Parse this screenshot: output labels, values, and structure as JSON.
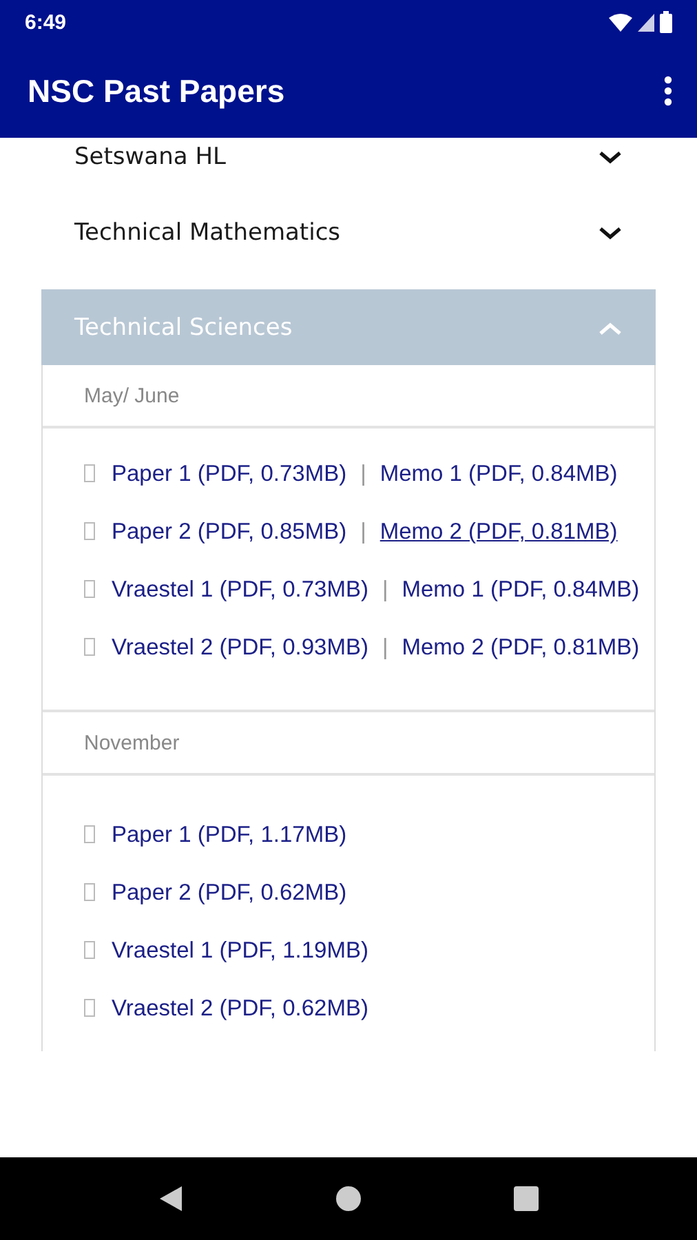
{
  "status_bar": {
    "time": "6:49"
  },
  "app_bar": {
    "title": "NSC Past Papers"
  },
  "subjects": [
    {
      "title": "Setswana HL",
      "expanded": false
    },
    {
      "title": "Technical Mathematics",
      "expanded": false
    },
    {
      "title": "Technical Sciences",
      "expanded": true,
      "sections": [
        {
          "title": "May/ June",
          "rows": [
            {
              "paper": {
                "text": "Paper 1 (PDF, 0.73MB)",
                "underlined": false
              },
              "separator": "|",
              "memo": {
                "text": "Memo 1 (PDF, 0.84MB)",
                "underlined": false
              }
            },
            {
              "paper": {
                "text": "Paper 2 (PDF, 0.85MB)",
                "underlined": false
              },
              "separator": "|",
              "memo": {
                "text": "Memo 2 (PDF, 0.81MB)",
                "underlined": true
              }
            },
            {
              "paper": {
                "text": "Vraestel 1 (PDF, 0.73MB)",
                "underlined": false
              },
              "separator": "|",
              "memo": {
                "text": "Memo 1 (PDF, 0.84MB)",
                "underlined": false
              }
            },
            {
              "paper": {
                "text": "Vraestel 2 (PDF, 0.93MB)",
                "underlined": false
              },
              "separator": "|",
              "memo": {
                "text": "Memo 2 (PDF, 0.81MB)",
                "underlined": false
              }
            }
          ]
        },
        {
          "title": "November",
          "rows": [
            {
              "paper": {
                "text": "Paper 1 (PDF, 1.17MB)",
                "underlined": false
              }
            },
            {
              "paper": {
                "text": "Paper 2 (PDF, 0.62MB)",
                "underlined": false
              }
            },
            {
              "paper": {
                "text": "Vraestel 1 (PDF, 1.19MB)",
                "underlined": false
              }
            },
            {
              "paper": {
                "text": "Vraestel 2 (PDF, 0.62MB)",
                "underlined": false
              }
            }
          ]
        }
      ]
    }
  ]
}
